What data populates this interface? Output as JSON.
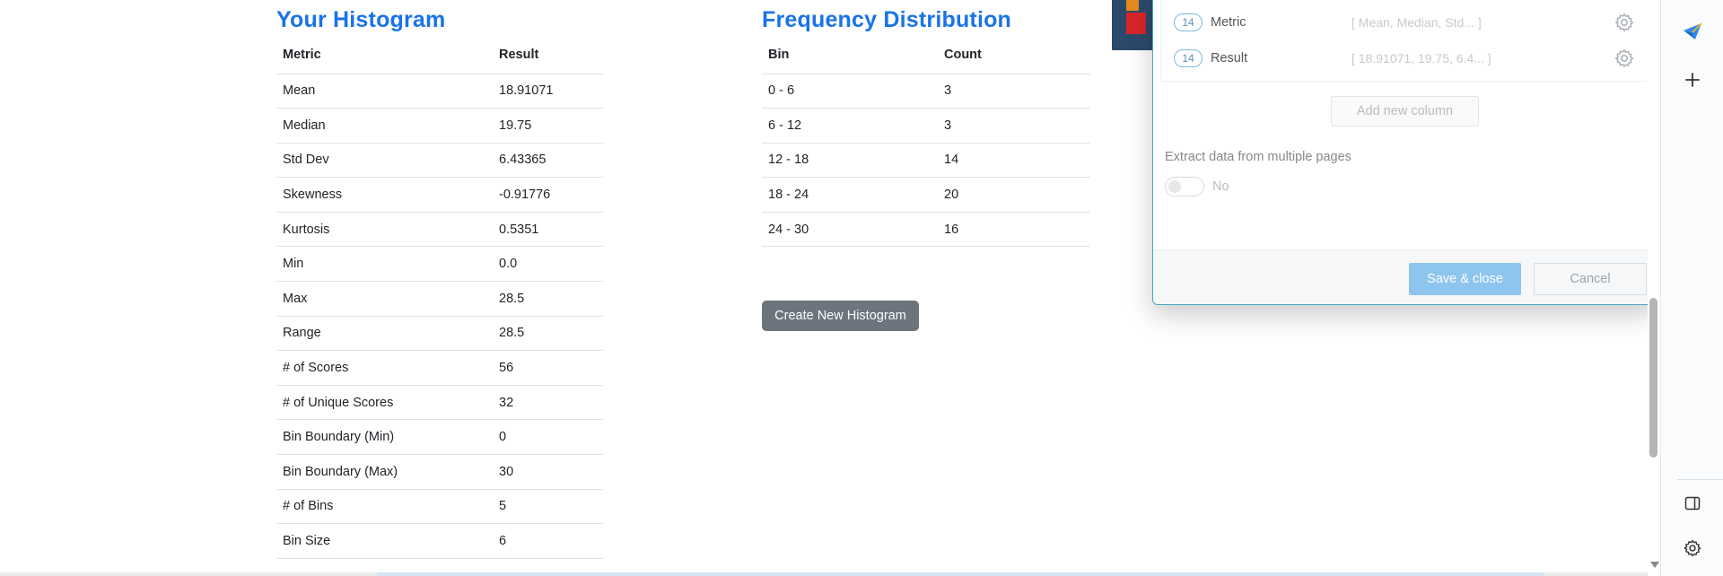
{
  "histogram": {
    "title": "Your Histogram",
    "headers": [
      "Metric",
      "Result"
    ],
    "rows": [
      [
        "Mean",
        "18.91071"
      ],
      [
        "Median",
        "19.75"
      ],
      [
        "Std Dev",
        "6.43365"
      ],
      [
        "Skewness",
        "-0.91776"
      ],
      [
        "Kurtosis",
        "0.5351"
      ],
      [
        "Min",
        "0.0"
      ],
      [
        "Max",
        "28.5"
      ],
      [
        "Range",
        "28.5"
      ],
      [
        "# of Scores",
        "56"
      ],
      [
        "# of Unique Scores",
        "32"
      ],
      [
        "Bin Boundary (Min)",
        "0"
      ],
      [
        "Bin Boundary (Max)",
        "30"
      ],
      [
        "# of Bins",
        "5"
      ],
      [
        "Bin Size",
        "6"
      ]
    ]
  },
  "frequency": {
    "title": "Frequency Distribution",
    "headers": [
      "Bin",
      "Count"
    ],
    "rows": [
      [
        "0 - 6",
        "3"
      ],
      [
        "6 - 12",
        "3"
      ],
      [
        "12 - 18",
        "14"
      ],
      [
        "18 - 24",
        "20"
      ],
      [
        "24 - 30",
        "16"
      ]
    ],
    "create_button": "Create New Histogram"
  },
  "dialog": {
    "columns": [
      {
        "count": "14",
        "name": "Metric",
        "preview": "[ Mean, Median, Std...  ]"
      },
      {
        "count": "14",
        "name": "Result",
        "preview": "[ 18.91071, 19.75, 6.4...  ]"
      }
    ],
    "add_column": "Add new column",
    "extract_label": "Extract data from multiple pages",
    "toggle_value": "No",
    "save_label": "Save & close",
    "cancel_label": "Cancel"
  },
  "colors": {
    "title_blue": "#1a73e8",
    "save_blue": "#8ec5ee",
    "create_gray": "#6c757d"
  },
  "sidebar_icons": [
    "send-icon",
    "plus-icon",
    "side-panel-icon",
    "settings-gear-icon"
  ]
}
